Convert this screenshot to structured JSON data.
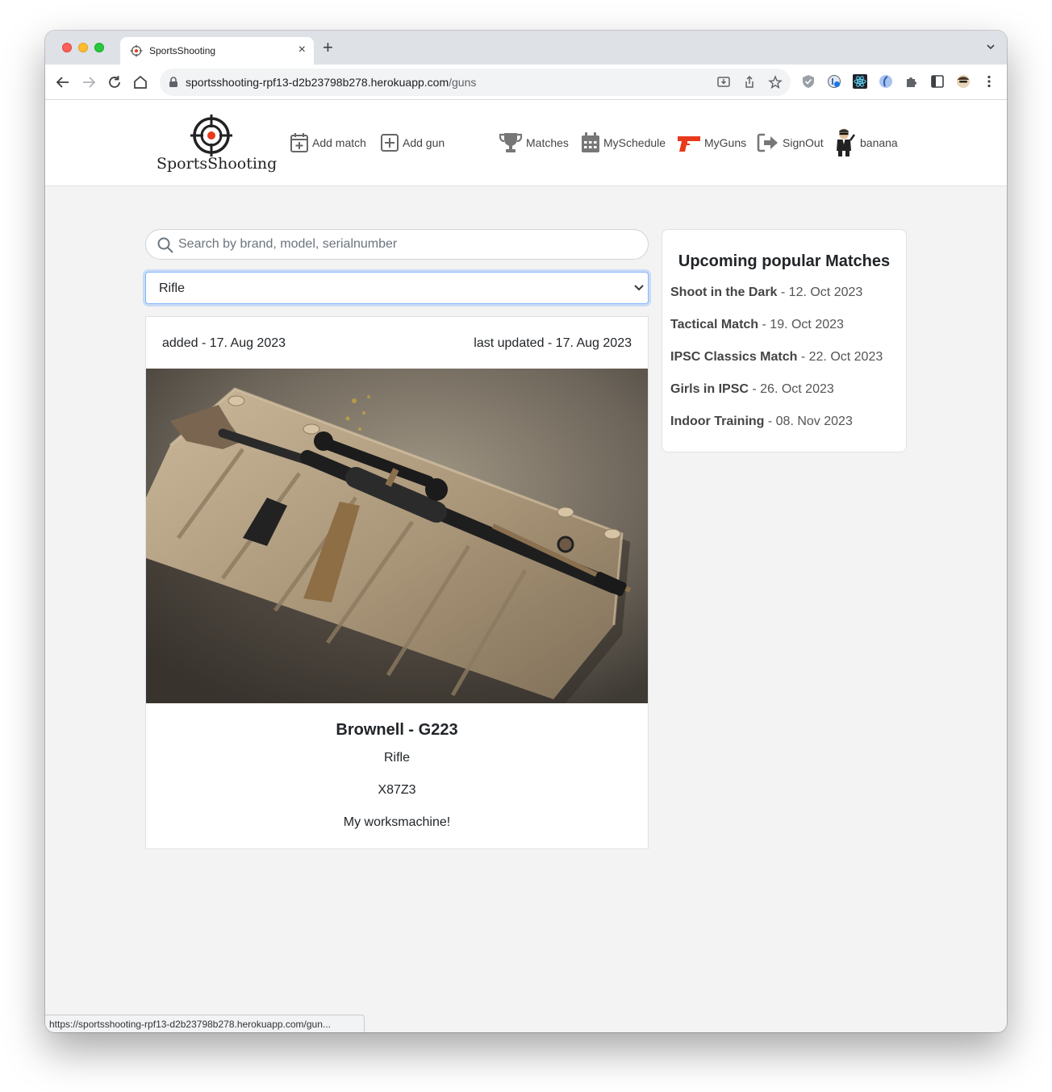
{
  "browser": {
    "tab_title": "SportsShooting",
    "url_host": "sportsshooting-rpf13-d2b23798b278.herokuapp.com",
    "url_path": "/guns",
    "status_url": "https://sportsshooting-rpf13-d2b23798b278.herokuapp.com/gun..."
  },
  "site": {
    "logo_text": "SportsShooting",
    "nav": {
      "add_match": "Add match",
      "add_gun": "Add gun",
      "matches": "Matches",
      "myschedule": "MySchedule",
      "myguns": "MyGuns",
      "signout": "SignOut",
      "user": "banana"
    },
    "accent_color": "#e8391d"
  },
  "search": {
    "placeholder": "Search by brand, model, serialnumber",
    "value": ""
  },
  "filter": {
    "selected": "Rifle"
  },
  "gun_card": {
    "added": "added - 17. Aug 2023",
    "updated": "last updated - 17. Aug 2023",
    "title": "Brownell - G223",
    "type": "Rifle",
    "serial": "X87Z3",
    "description": "My worksmachine!"
  },
  "popular_matches": {
    "title": "Upcoming popular Matches",
    "items": [
      {
        "name": "Shoot in the Dark",
        "date": " - 12. Oct 2023"
      },
      {
        "name": "Tactical Match",
        "date": " - 19. Oct 2023"
      },
      {
        "name": "IPSC Classics Match",
        "date": " - 22. Oct 2023"
      },
      {
        "name": "Girls in IPSC",
        "date": " - 26. Oct 2023"
      },
      {
        "name": "Indoor Training",
        "date": " - 08. Nov 2023"
      }
    ]
  }
}
